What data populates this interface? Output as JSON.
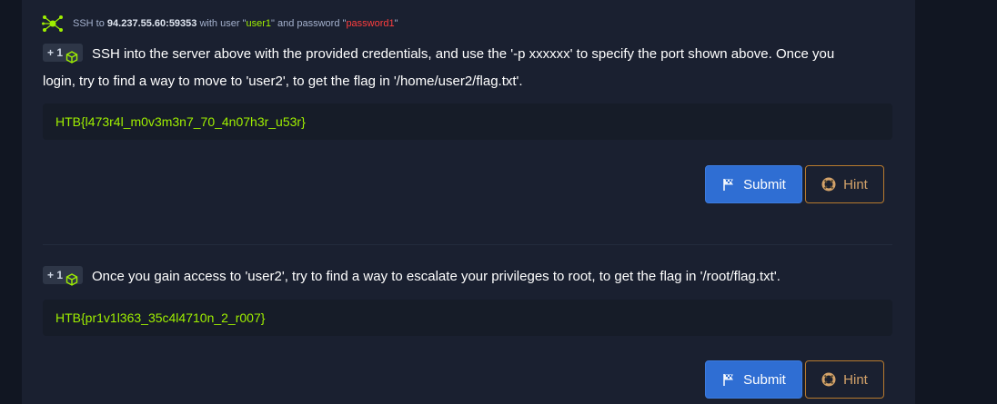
{
  "target": {
    "prefix": "SSH to",
    "address": "94.237.55.60:59353",
    "with_user": "with user",
    "user_quote_open": "\"",
    "user": "user1",
    "user_quote_close": "\"",
    "and_password": "and password",
    "pass_quote_open": "\"",
    "password": "password1",
    "pass_quote_close": "\""
  },
  "questions": [
    {
      "badge": "+ 1",
      "line1": "SSH into the server above with the provided credentials, and use the '-p xxxxxx' to specify the port shown above. Once you",
      "line2": "login, try to find a way to move to 'user2', to get the flag in '/home/user2/flag.txt'.",
      "answer": "HTB{l473r4l_m0v3m3n7_70_4n07h3r_u53r}",
      "submit_label": "Submit",
      "hint_label": "Hint"
    },
    {
      "badge": "+ 1",
      "line1": "Once you gain access to 'user2', try to find a way to escalate your privileges to root, to get the flag in '/root/flag.txt'.",
      "answer": "HTB{pr1v1l363_35c4l4710n_2_r007}",
      "submit_label": "Submit",
      "hint_label": "Hint"
    }
  ],
  "icons": {
    "target": "network-target-icon",
    "badge": "cube-icon",
    "submit": "flag-icon",
    "hint": "lifebuoy-icon"
  },
  "colors": {
    "accent_green": "#9fef00",
    "password_red": "#ff3e3e",
    "submit_blue": "#2f6ed3",
    "hint_orange": "#b77a2e"
  }
}
